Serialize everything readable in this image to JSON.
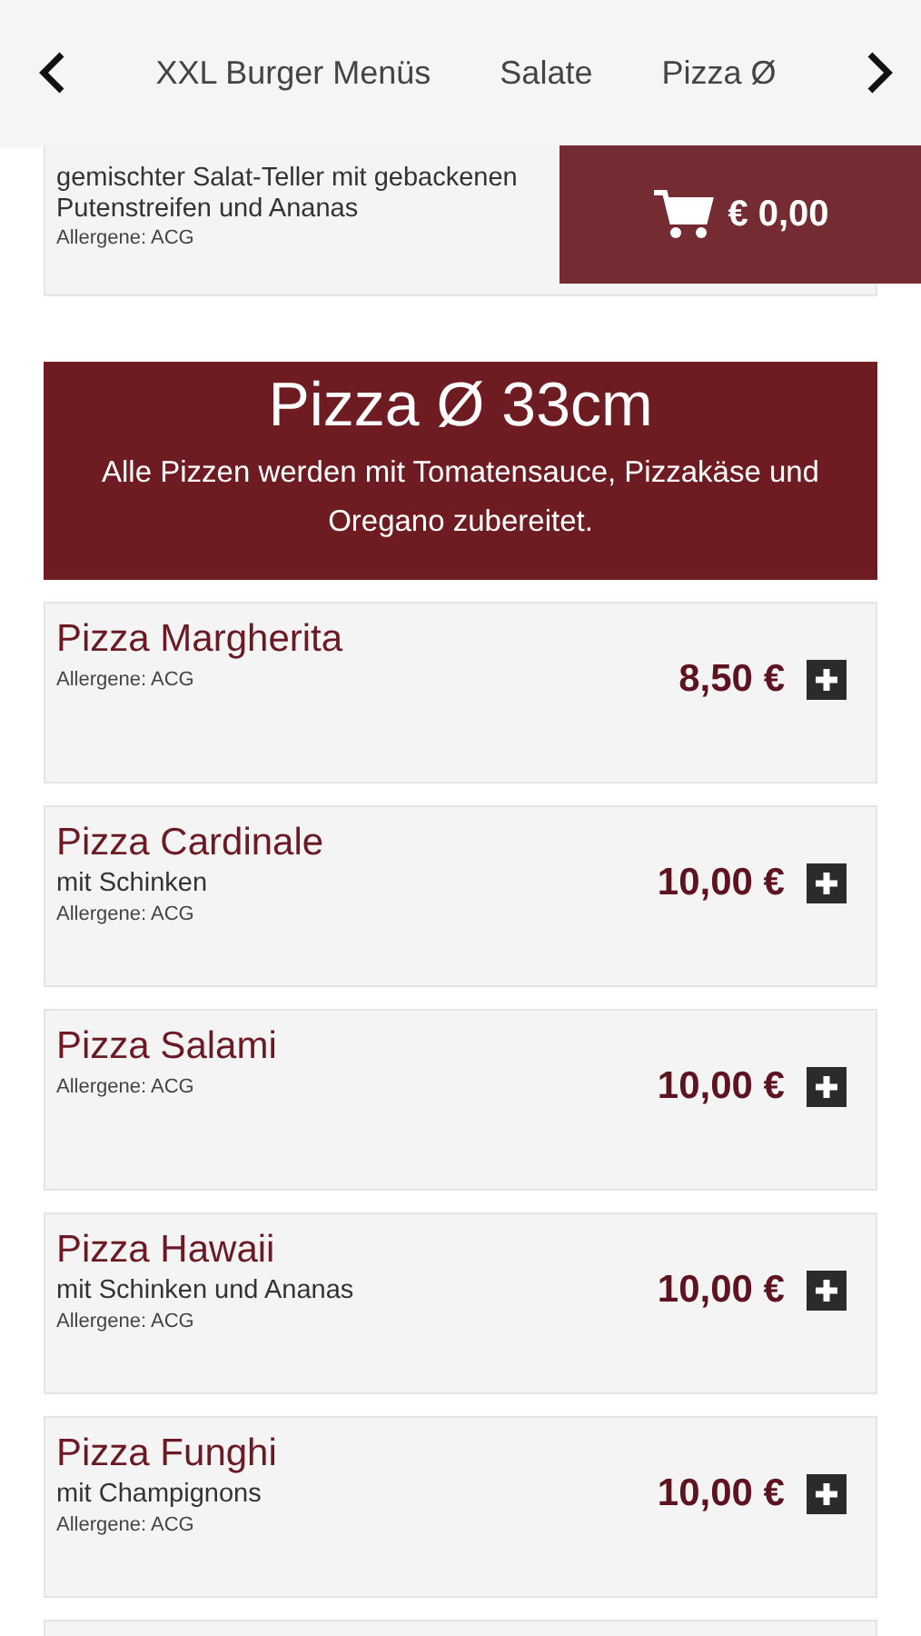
{
  "nav": {
    "tabs": [
      {
        "label": "XXL Burger Menüs",
        "selected": false
      },
      {
        "label": "Salate",
        "selected": false
      },
      {
        "label": "Pizza Ø",
        "selected": false
      }
    ]
  },
  "cart": {
    "total": "€ 0,00"
  },
  "partial_item": {
    "description": "gemischter Salat-Teller mit gebackenen Putenstreifen und Ananas",
    "allergens": "Allergene: ACG"
  },
  "section": {
    "title": "Pizza Ø 33cm",
    "subtitle": "Alle Pizzen werden mit Tomatensauce, Pizzakäse und Oregano zubereitet."
  },
  "items": [
    {
      "name": "Pizza Margherita",
      "allergens": "Allergene: ACG",
      "price": "8,50 €"
    },
    {
      "name": "Pizza Cardinale",
      "description": "mit Schinken",
      "allergens": "Allergene: ACG",
      "price": "10,00 €"
    },
    {
      "name": "Pizza Salami",
      "allergens": "Allergene: ACG",
      "price": "10,00 €"
    },
    {
      "name": "Pizza Hawaii",
      "description": "mit Schinken und Ananas",
      "allergens": "Allergene: ACG",
      "price": "10,00 €"
    },
    {
      "name": "Pizza Funghi",
      "description": "mit Champignons",
      "allergens": "Allergene: ACG",
      "price": "10,00 €"
    }
  ]
}
